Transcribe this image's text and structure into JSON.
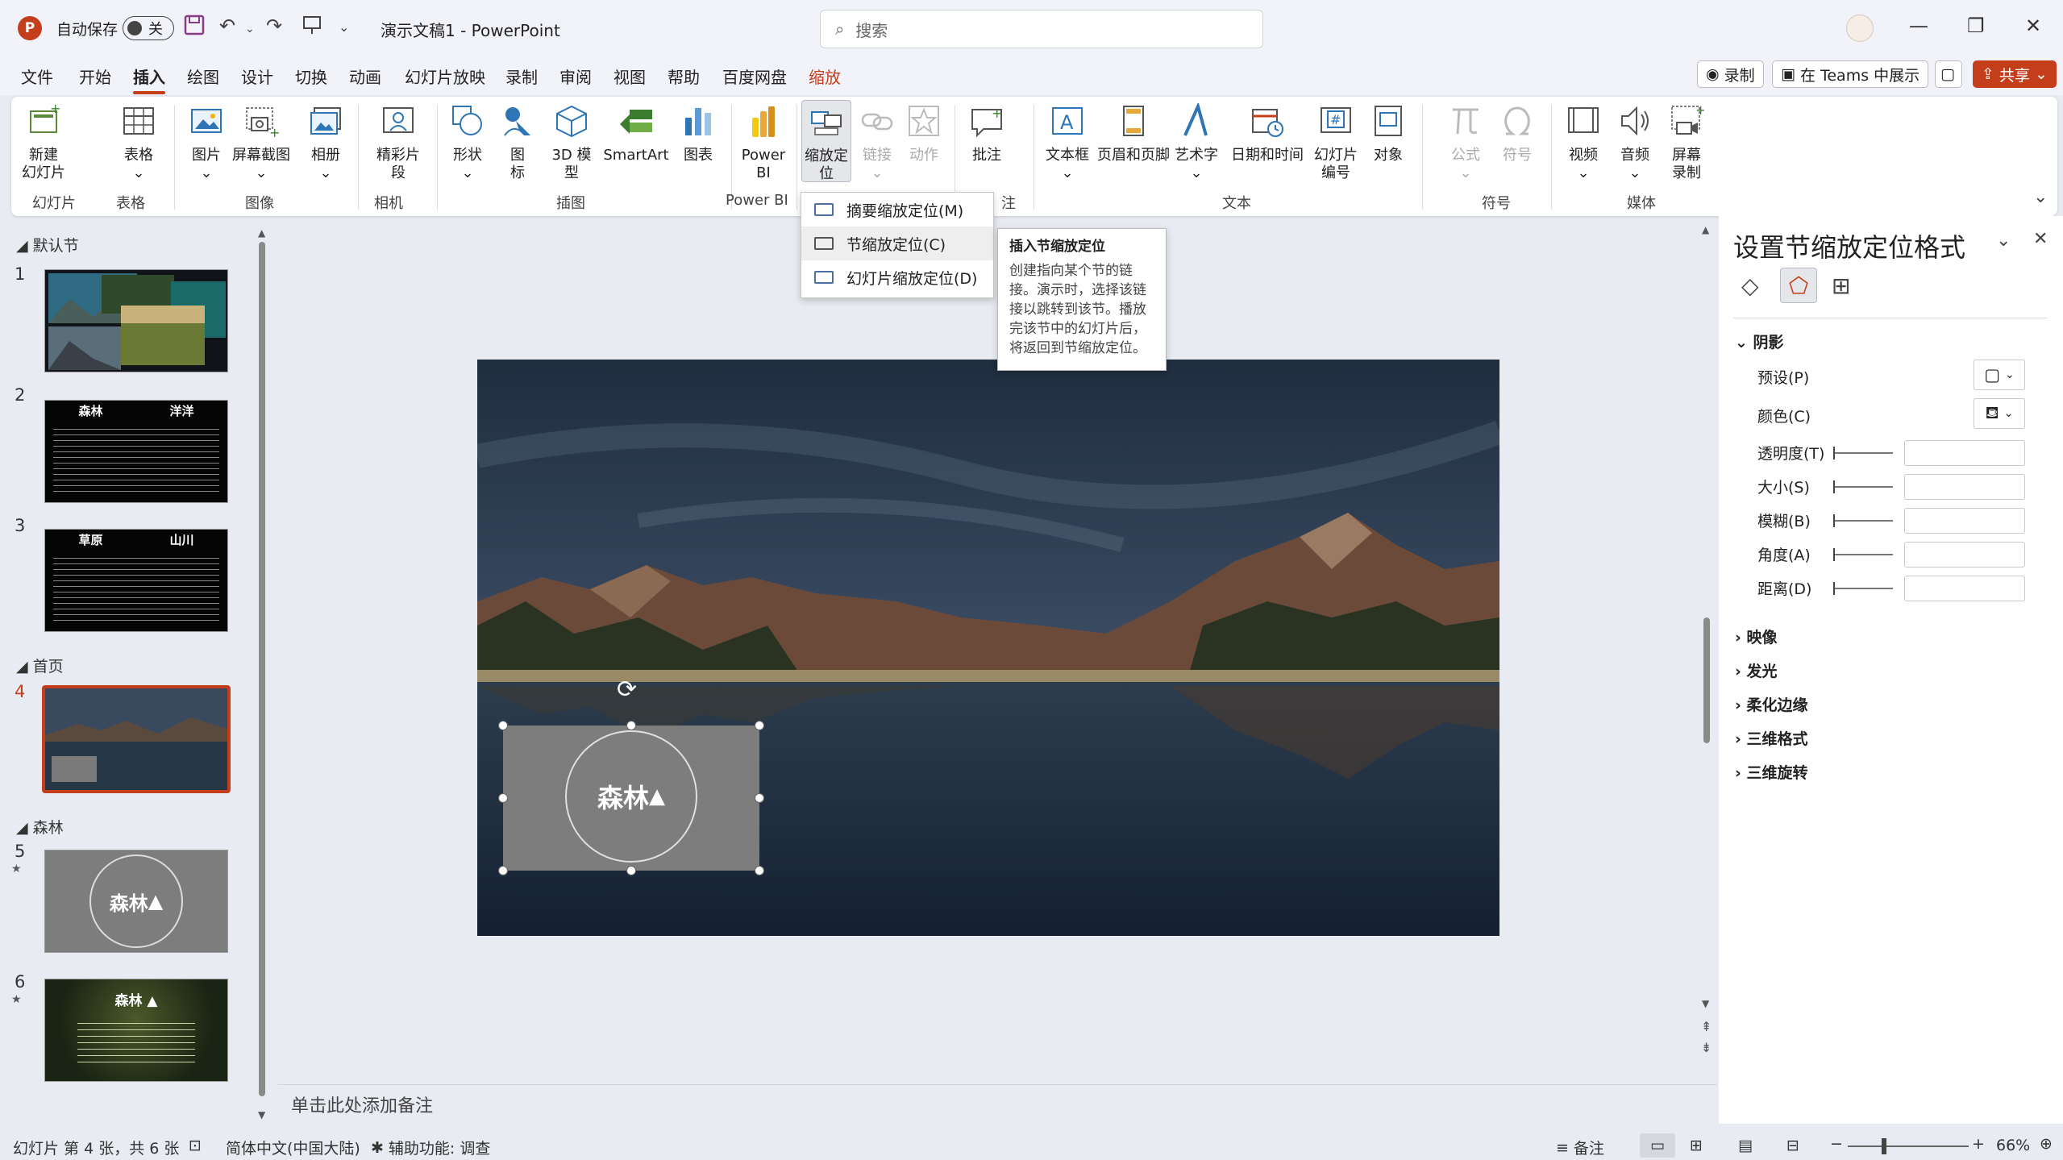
{
  "titlebar": {
    "logo": "P",
    "autosave_label": "自动保存",
    "autosave_state": "关",
    "doc_title": "演示文稿1  -  PowerPoint",
    "search_placeholder": "搜索"
  },
  "menu": {
    "tabs": [
      "文件",
      "开始",
      "插入",
      "绘图",
      "设计",
      "切换",
      "动画",
      "幻灯片放映",
      "录制",
      "审阅",
      "视图",
      "帮助",
      "百度网盘",
      "缩放"
    ],
    "active_tab": "插入",
    "record_label": "录制",
    "teams_label": "在 Teams 中展示",
    "share_label": "共享"
  },
  "ribbon": {
    "new_slide": "新建\n幻灯片",
    "table": "表格",
    "picture": "图片",
    "screenshot": "屏幕截图",
    "album": "相册",
    "cameo": "精彩片\n段",
    "shapes": "形状",
    "icons": "图\n标",
    "model3d": "3D 模\n型",
    "smartart": "SmartArt",
    "chart": "图表",
    "powerbi": "Power\nBI",
    "zoom": "缩放定\n位",
    "link": "链接",
    "action": "动作",
    "comment": "批注",
    "textbox": "文本框",
    "header_footer": "页眉和页脚",
    "wordart": "艺术字",
    "datetime": "日期和时间",
    "slide_number": "幻灯片\n编号",
    "object": "对象",
    "equation": "公式",
    "symbol": "符号",
    "video": "视频",
    "audio": "音频",
    "screen_record": "屏幕\n录制",
    "groups": {
      "slides": "幻灯片",
      "tables": "表格",
      "images": "图像",
      "camera": "相机",
      "illustrations": "插图",
      "powerbi": "Power BI",
      "comments": "注",
      "text": "文本",
      "symbols": "符号",
      "media": "媒体"
    }
  },
  "zoom_dropdown": {
    "items": [
      "摘要缩放定位(M)",
      "节缩放定位(C)",
      "幻灯片缩放定位(D)"
    ],
    "highlighted": 1
  },
  "tooltip": {
    "title": "插入节缩放定位",
    "body": "创建指向某个节的链接。演示时，选择该链接以跳转到该节。播放完该节中的幻灯片后，将返回到节缩放定位。"
  },
  "slides_panel": {
    "sections": [
      "默认节",
      "首页",
      "森林"
    ],
    "slides": [
      {
        "num": "1",
        "label": ""
      },
      {
        "num": "2",
        "label_left": "森林",
        "label_right": "洋洋"
      },
      {
        "num": "3",
        "label_left": "草原",
        "label_right": "山川"
      },
      {
        "num": "4",
        "label": ""
      },
      {
        "num": "5",
        "label": "森林"
      },
      {
        "num": "6",
        "label": "森林"
      }
    ],
    "selected": 4
  },
  "slide": {
    "zoom_label": "森林"
  },
  "notes": {
    "placeholder": "单击此处添加备注"
  },
  "format_pane": {
    "title": "设置节缩放定位格式",
    "section_open": "阴影",
    "props": [
      "预设(P)",
      "颜色(C)",
      "透明度(T)",
      "大小(S)",
      "模糊(B)",
      "角度(A)",
      "距离(D)"
    ],
    "sections_closed": [
      "映像",
      "发光",
      "柔化边缘",
      "三维格式",
      "三维旋转"
    ]
  },
  "status": {
    "slide_info": "幻灯片 第 4 张，共 6 张",
    "language": "简体中文(中国大陆)",
    "accessibility": "辅助功能: 调查",
    "notes_btn": "备注",
    "zoom": "66%"
  },
  "colors": {
    "accent": "#c43e1c",
    "pane_bg": "#ffffff",
    "app_bg": "#e8ebf1"
  }
}
